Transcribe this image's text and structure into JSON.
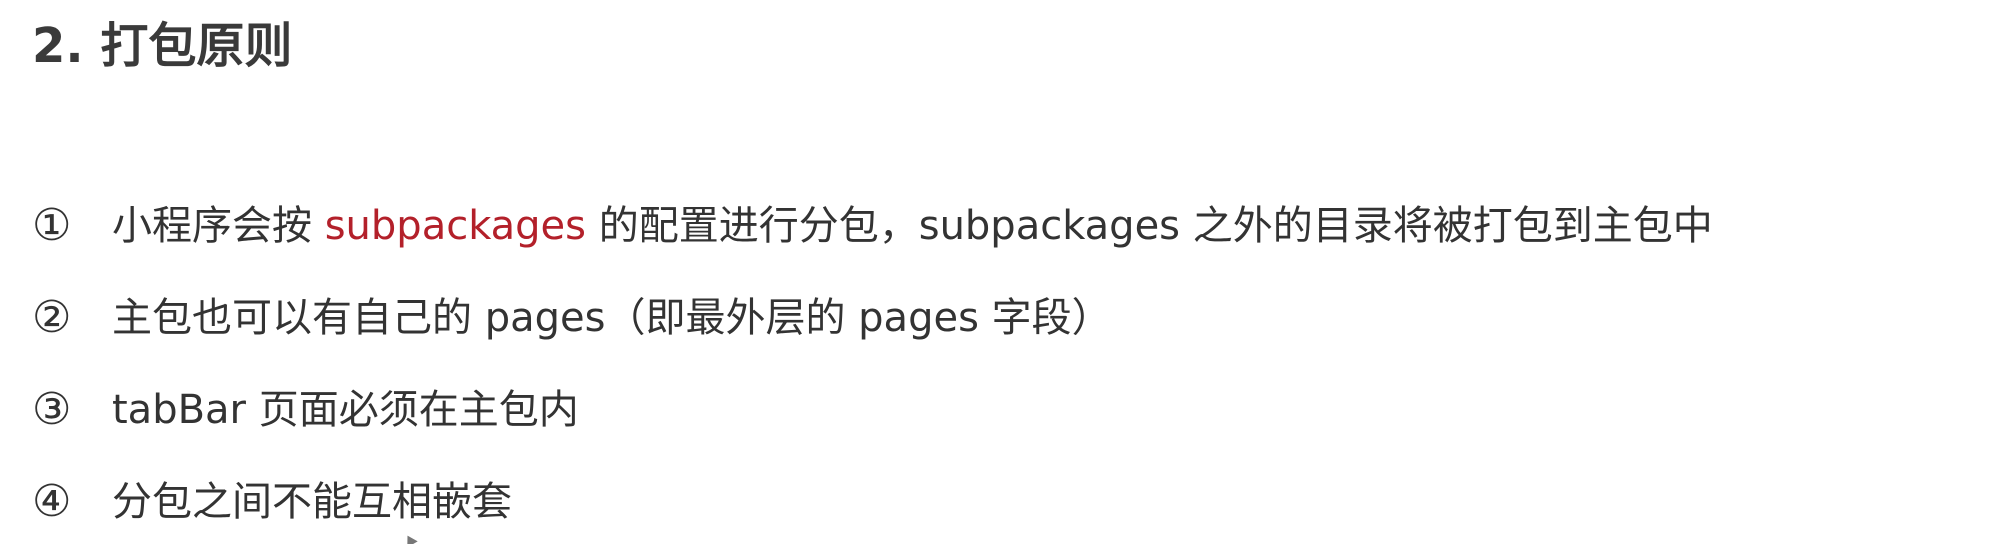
{
  "title": "2. 打包原则",
  "items": [
    {
      "marker": "①",
      "before": "小程序会按 ",
      "highlight": "subpackages",
      "after": " 的配置进行分包，subpackages 之外的目录将被打包到主包中"
    },
    {
      "marker": "②",
      "before": "主包也可以有自己的 pages（即最外层的 pages 字段）",
      "highlight": "",
      "after": ""
    },
    {
      "marker": "③",
      "before": "tabBar 页面必须在主包内",
      "highlight": "",
      "after": ""
    },
    {
      "marker": "④",
      "before": "分包之间不能互相嵌套",
      "highlight": "",
      "after": ""
    }
  ],
  "colors": {
    "text": "#333333",
    "highlight": "#b3202a",
    "background": "#ffffff"
  }
}
